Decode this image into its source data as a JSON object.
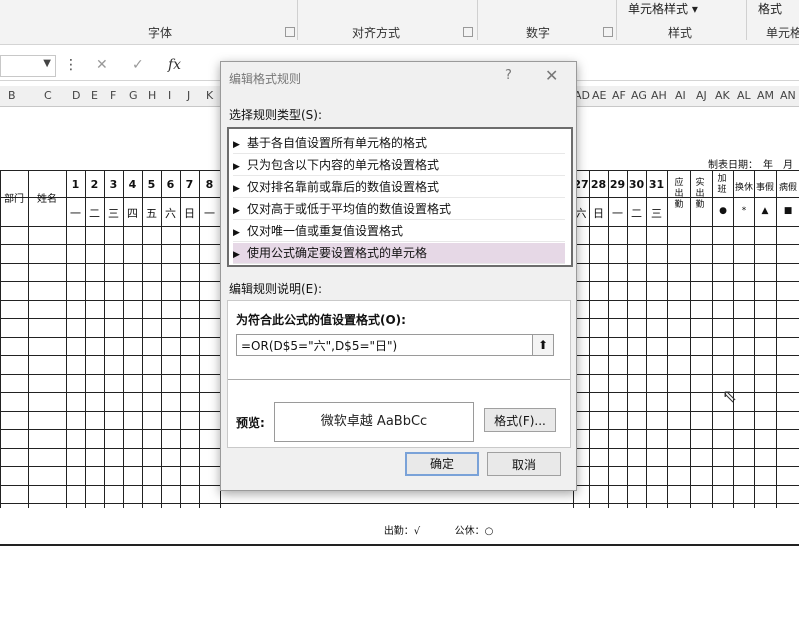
{
  "ribbon": {
    "groups": [
      "字体",
      "对齐方式",
      "数字",
      "样式",
      "单元格"
    ],
    "top_items": [
      "单元格样式",
      "格式"
    ]
  },
  "formula_bar": {
    "cancel_icon": "✕",
    "enter_icon": "✓",
    "fx_label": "fx"
  },
  "column_headers_left": [
    "B",
    "C",
    "D",
    "E",
    "F",
    "G",
    "H",
    "I",
    "J",
    "K"
  ],
  "column_headers_right": [
    "AD",
    "AE",
    "AF",
    "AG",
    "AH",
    "AI",
    "AJ",
    "AK",
    "AL",
    "AM",
    "AN"
  ],
  "sheet": {
    "make_date": "制表日期：　年　月",
    "col_dept": "部门",
    "col_name": "姓名",
    "days_left": [
      "1",
      "2",
      "3",
      "4",
      "5",
      "6",
      "7",
      "8"
    ],
    "weekdays_left": [
      "一",
      "二",
      "三",
      "四",
      "五",
      "六",
      "日",
      "一"
    ],
    "days_right": [
      "27",
      "28",
      "29",
      "30",
      "31"
    ],
    "weekdays_right": [
      "六",
      "日",
      "一",
      "二",
      "三"
    ],
    "extra_headers": [
      "应出勤",
      "实出勤",
      "加班",
      "换休",
      "事假",
      "病假"
    ],
    "extra_symbols": [
      "",
      "",
      "●",
      "*",
      "▲",
      "■"
    ],
    "footer_attend": "出勤：√",
    "footer_holiday": "公休：○"
  },
  "dialog": {
    "title": "编辑格式规则",
    "help": "?",
    "close": "✕",
    "select_rule_label": "选择规则类型(S):",
    "rule_types": [
      "基于各自值设置所有单元格的格式",
      "只为包含以下内容的单元格设置格式",
      "仅对排名靠前或靠后的数值设置格式",
      "仅对高于或低于平均值的数值设置格式",
      "仅对唯一值或重复值设置格式",
      "使用公式确定要设置格式的单元格"
    ],
    "selected_index": 5,
    "edit_desc_label": "编辑规则说明(E):",
    "formula_label": "为符合此公式的值设置格式(O):",
    "formula_value": "=OR(D$5=\"六\",D$5=\"日\")",
    "preview_label": "预览:",
    "preview_text": "微软卓越  AaBbCc",
    "format_button": "格式(F)...",
    "ok_button": "确定",
    "cancel_button": "取消"
  }
}
